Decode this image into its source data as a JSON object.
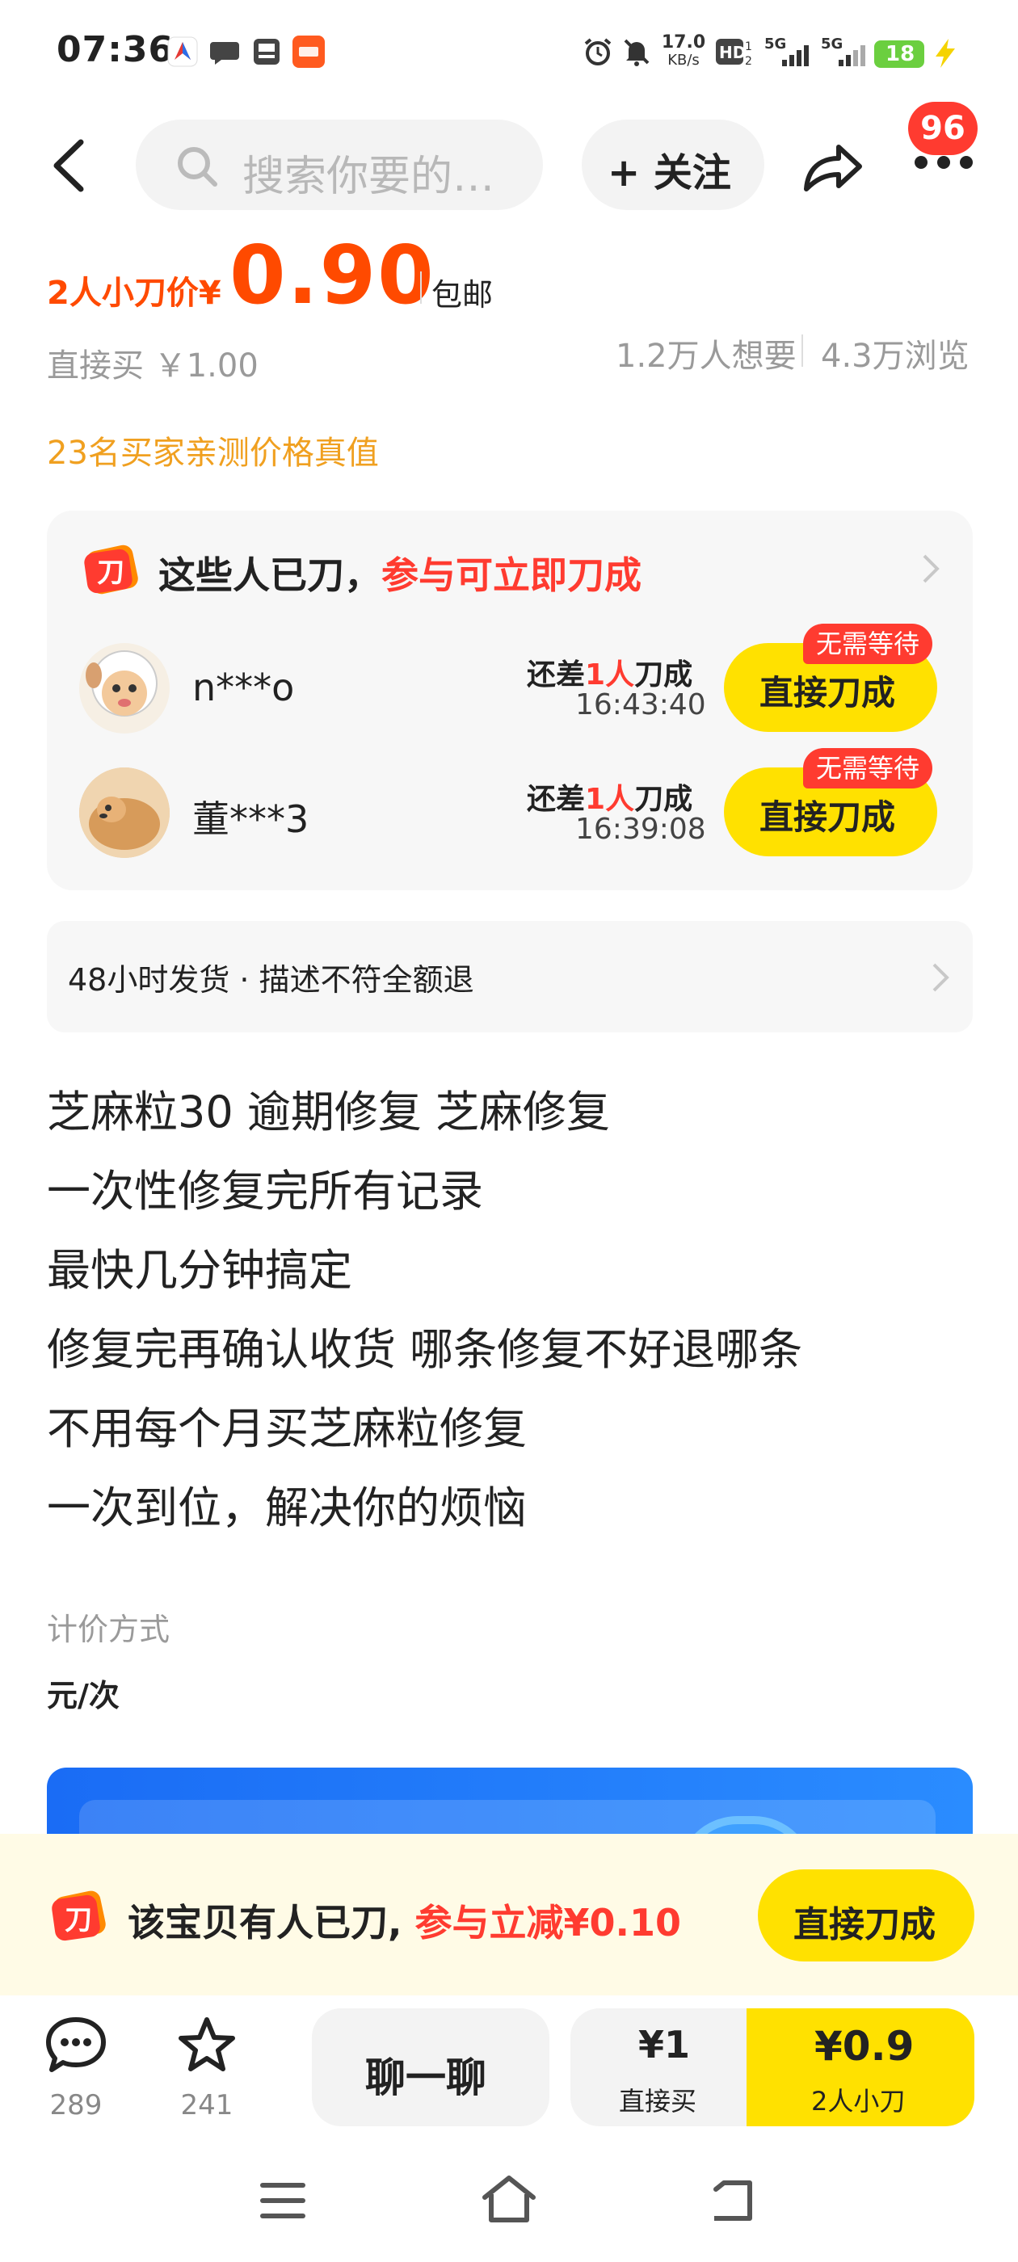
{
  "status_bar": {
    "time": "07:36",
    "speed": "17.0",
    "speed_unit": "KB/s",
    "battery": "18"
  },
  "header": {
    "search_placeholder": "搜索你要的…",
    "follow_label": "+ 关注",
    "badge_count": "96"
  },
  "price": {
    "prefix": "2人小刀价¥",
    "value": "0.90",
    "shipping": "包邮",
    "direct_buy": "直接买 ￥1.00",
    "wants": "1.2万人想要",
    "views": "4.3万浏览",
    "tested_note": "23名买家亲测价格真值"
  },
  "cut_card": {
    "title_black": "这些人已刀，",
    "title_red": "参与可立即刀成",
    "rows": [
      {
        "name": "n***o",
        "need_pre": "还差",
        "need_num": "1人",
        "need_post": "刀成",
        "time": "16:43:40",
        "button": "直接刀成",
        "tag": "无需等待"
      },
      {
        "name": "董***3",
        "need_pre": "还差",
        "need_num": "1人",
        "need_post": "刀成",
        "time": "16:39:08",
        "button": "直接刀成",
        "tag": "无需等待"
      }
    ]
  },
  "service": {
    "text": "48小时发货 · 描述不符全额退"
  },
  "description": [
    "芝麻粒30 逾期修复 芝麻修复",
    "一次性修复完所有记录",
    "最快几分钟搞定",
    "修复完再确认收货 哪条修复不好退哪条",
    "不用每个月买芝麻粒修复",
    "一次到位，解决你的烦恼"
  ],
  "pricing": {
    "label": "计价方式",
    "value": "元/次"
  },
  "promo": {
    "text_black": "该宝贝有人已刀, ",
    "text_red": "参与立减¥0.10",
    "button": "直接刀成"
  },
  "bottom_bar": {
    "comments_count": "289",
    "favorites_count": "241",
    "chat_label": "聊一聊",
    "direct_price": "¥1",
    "direct_label": "直接买",
    "cut_price": "¥0.9",
    "cut_label": "2人小刀"
  },
  "colors": {
    "accent_orange": "#ff4a00",
    "accent_red": "#ff3b30",
    "accent_yellow": "#ffe100",
    "tested_orange": "#f0a020"
  }
}
